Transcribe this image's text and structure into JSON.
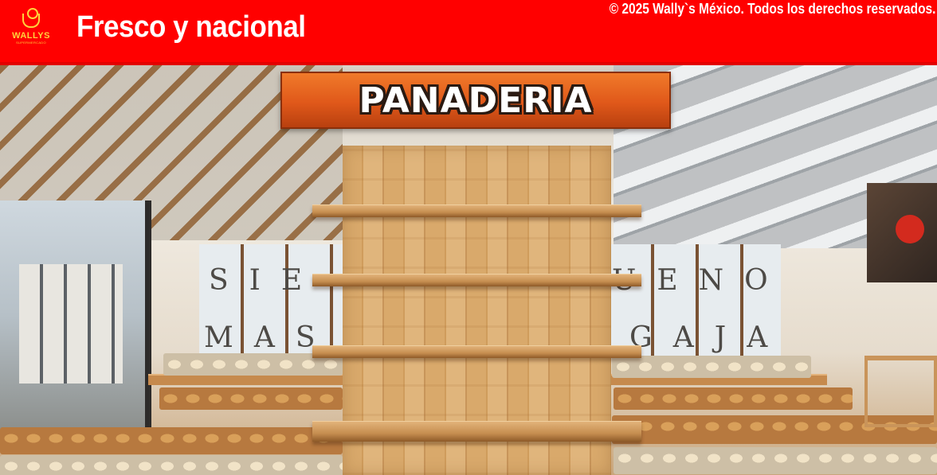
{
  "header": {
    "title": "Fresco y nacional",
    "copyright": "© 2025 Wally`s México. Todos los derechos reservados.",
    "logo": {
      "name": "WALLYS",
      "tagline": "SUPERMERCADO"
    }
  },
  "scene": {
    "sign_text": "PANADERIA",
    "wall_text_left_top": "SIE",
    "wall_text_left_bottom": "MAS",
    "wall_text_right_top": "UENO",
    "wall_text_right_bottom": "GAJA",
    "shelf_levels": 4
  },
  "colors": {
    "header_bg": "#ff0000",
    "logo_yellow": "#ffd23c",
    "sign_orange": "#e0581a",
    "wood": "#d8a86a"
  }
}
